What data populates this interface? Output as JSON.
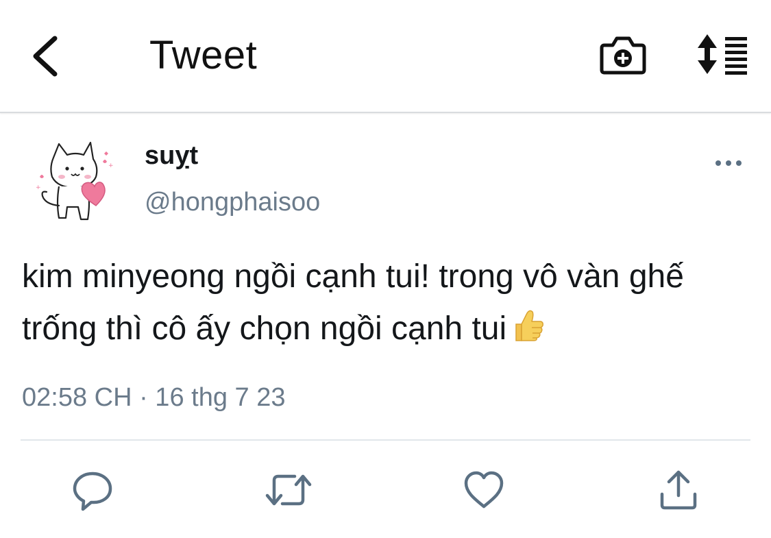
{
  "header": {
    "title": "Tweet",
    "back_icon": "chevron-left-icon",
    "camera_icon": "camera-plus-icon",
    "sort_icon": "sort-list-icon"
  },
  "tweet": {
    "author": {
      "display_name": "suỵt",
      "handle": "@hongphaisoo",
      "avatar": "cat-with-heart-avatar"
    },
    "text": "kim minyeong ngồi cạnh tui! trong vô vàn ghế trống thì cô ấy chọn ngồi cạnh tui",
    "emoji": "thumbs-up-emoji",
    "timestamp": "02:58 CH · 16 thg 7 23",
    "more_icon": "more-horizontal-icon"
  },
  "actions": [
    {
      "name": "reply",
      "icon": "reply-icon"
    },
    {
      "name": "retweet",
      "icon": "retweet-icon"
    },
    {
      "name": "like",
      "icon": "heart-icon"
    },
    {
      "name": "share",
      "icon": "share-icon"
    }
  ],
  "colors": {
    "text_primary": "#14171a",
    "text_secondary": "#6b7b8b",
    "icon_action": "#5b7083",
    "divider": "#e1e6ea",
    "heart_pink": "#ef7a9c"
  }
}
